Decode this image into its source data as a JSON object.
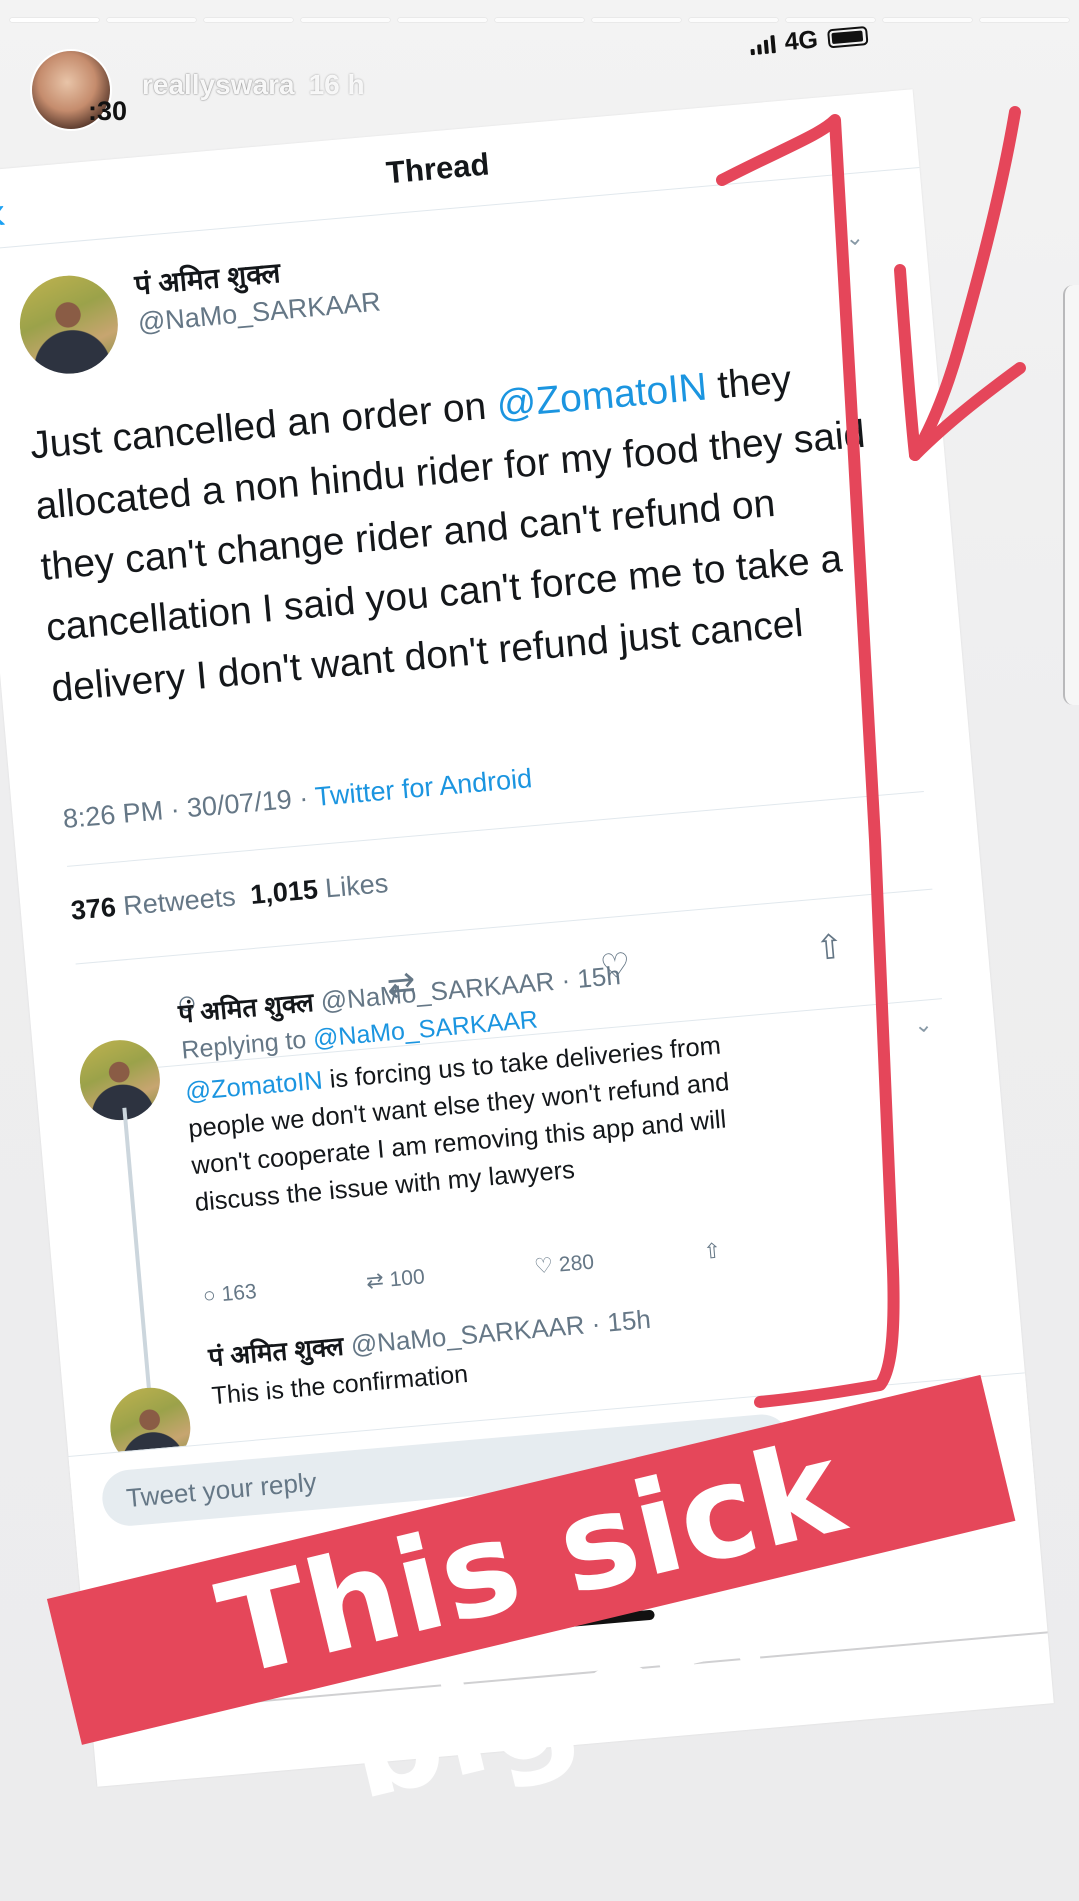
{
  "story": {
    "username": "reallyswara",
    "time_ago": "16 h",
    "clock_fragment": ":30",
    "progress_segments": 11,
    "progress_done": 1
  },
  "status_bar": {
    "network": "4G"
  },
  "thread": {
    "title": "Thread",
    "main_tweet": {
      "name": "पं अमित शुक्ल",
      "handle": "@NaMo_SARKAAR",
      "text_before_mention": "Just cancelled an order on ",
      "mention": "@ZomatoIN",
      "text_after_mention": " they allocated a non hindu rider for my food they said they can't change rider and can't refund on cancellation I said you can't force me to take a delivery I don't want don't refund just cancel",
      "timestamp": "8:26 PM · 30/07/19 · ",
      "source": "Twitter for Android",
      "retweets_count": "376",
      "retweets_label": "Retweets",
      "likes_count": "1,015",
      "likes_label": "Likes"
    },
    "reply_1": {
      "name": "पं अमित शुक्ल",
      "handle_time": "@NaMo_SARKAAR · 15h",
      "replying_to_label": "Replying to ",
      "replying_to_handle": "@NaMo_SARKAAR",
      "mention": "@ZomatoIN",
      "text": " is forcing us to take deliveries from people we don't want else they won't refund and won't cooperate I am removing this app and will discuss the issue with my lawyers",
      "reply_count": "163",
      "retweet_count": "100",
      "like_count": "280"
    },
    "reply_2": {
      "name": "पं अमित शुक्ल",
      "handle_time": "@NaMo_SARKAAR · 15h",
      "text": "This is the confirmation"
    },
    "reply_placeholder": "Tweet your reply"
  },
  "sticker": {
    "text": "This sick bigot!",
    "color": "#e5475a"
  },
  "colors": {
    "twitter_blue": "#1b95e0",
    "pen_red": "#e5465a"
  }
}
